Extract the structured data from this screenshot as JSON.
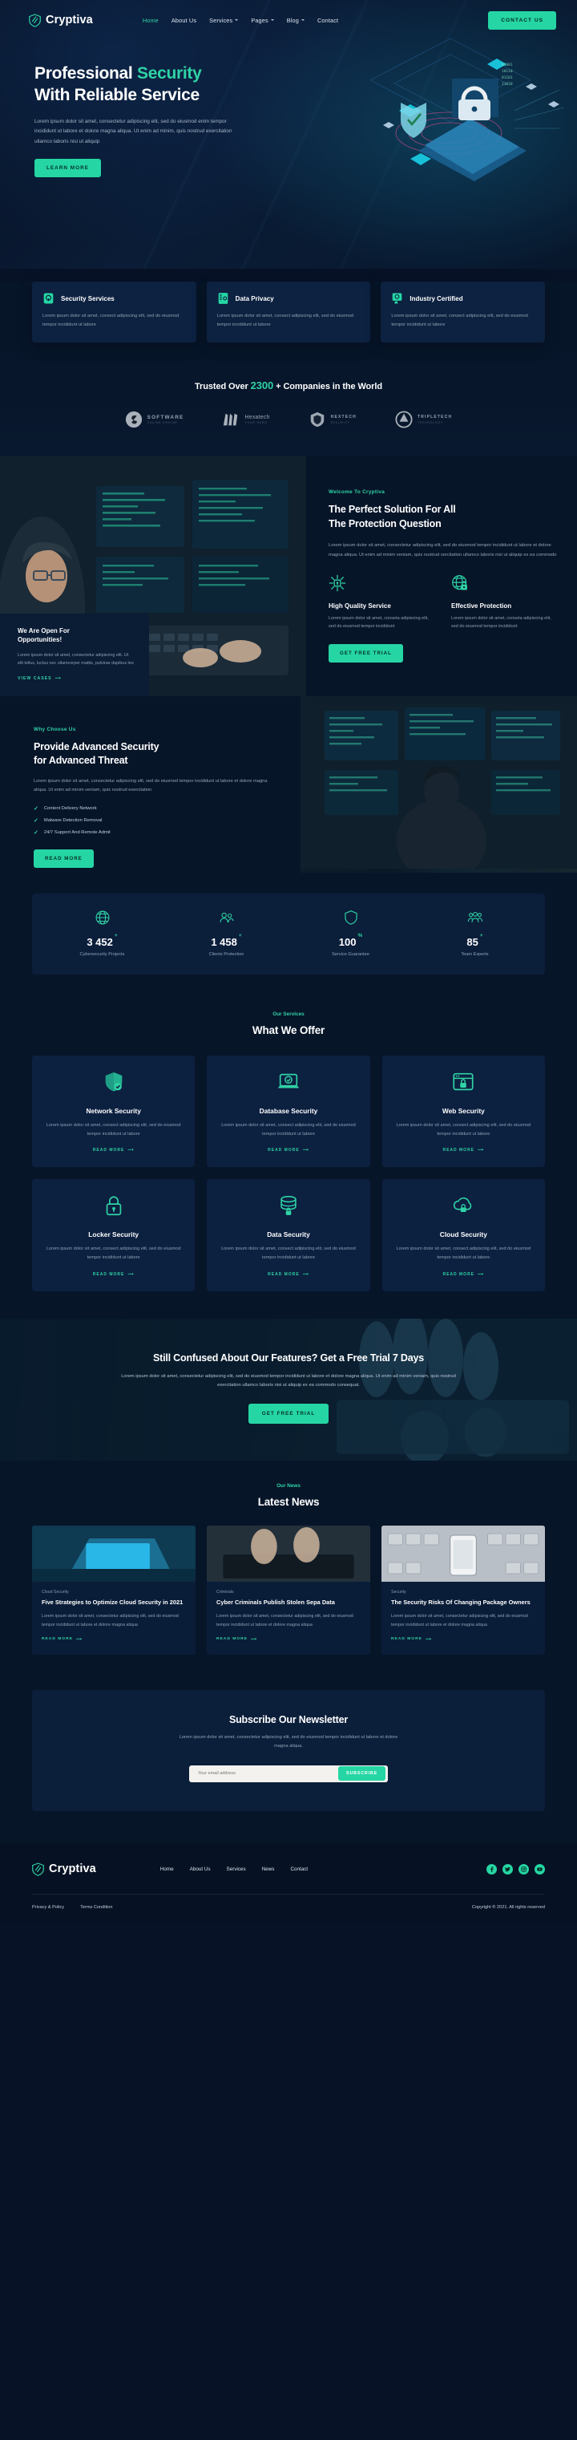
{
  "brand": {
    "name": "Cryptiva",
    "icon": "shield-icon"
  },
  "nav": {
    "items": [
      {
        "label": "Home",
        "active": true,
        "caret": false
      },
      {
        "label": "About Us",
        "active": false,
        "caret": false
      },
      {
        "label": "Services",
        "active": false,
        "caret": true
      },
      {
        "label": "Pages",
        "active": false,
        "caret": true
      },
      {
        "label": "Blog",
        "active": false,
        "caret": true
      },
      {
        "label": "Contact",
        "active": false,
        "caret": false
      }
    ],
    "cta": "CONTACT US"
  },
  "hero": {
    "title_line1_a": "Professional ",
    "title_line1_b": "Security",
    "title_line2": "With Reliable Service",
    "text": "Lorem ipsum dolor sit amet, consectetur adipiscing elit, sed do eiusmod enim tempor incididunt ut labore et dolore magna aliqua. Ut enim ad minim, quis nostrud exercitation ullamco laboris nisi ut aliquip",
    "button": "LEARN MORE"
  },
  "features": [
    {
      "icon": "lock-shield-icon",
      "title": "Security Services",
      "text": "Lorem ipsum dolor sit amet, consect adipiscing elit, sed do eiusmod tempor incididunt ut labore"
    },
    {
      "icon": "document-lock-icon",
      "title": "Data Privacy",
      "text": "Lorem ipsum dolor sit amet, consect adipiscing elit, sed do eiusmod tempor incididunt ut labore"
    },
    {
      "icon": "certificate-icon",
      "title": "Industry Certified",
      "text": "Lorem ipsum dolor sit amet, consect adipiscing elit, sed do eiusmod tempor incididunt ut labore"
    }
  ],
  "trusted": {
    "prefix": "Trusted Over ",
    "number": "2300",
    "suffix": " + Companies in the World",
    "logos": [
      {
        "icon": "swirl-logo-icon",
        "name": "SOFTWARE",
        "sub": "ONLINE ENGINE"
      },
      {
        "icon": "bars-logo-icon",
        "name": "Hexatech",
        "sub": "YOUR HERO"
      },
      {
        "icon": "shield-logo-icon",
        "name": "HEXTECH",
        "sub": "SECURITY"
      },
      {
        "icon": "circle-logo-icon",
        "name": "TRIPLETECH",
        "sub": "TECHNOLOGY"
      }
    ]
  },
  "about": {
    "eyebrow": "Welcome To Cryptiva",
    "title_line1": "The Perfect Solution For All",
    "title_line2": "The Protection Question",
    "text": "Lorem ipsum dolor sit amet, consectetur adipiscing elit, sed do eiusmod tempor incididunt ut labore et dolore magna aliqua. Ut enim ad minim veniam, quis nostrud xercitation ullamco laboris nisi ut aliquip ex ea commodo",
    "minis": [
      {
        "icon": "lock-network-icon",
        "title": "High Quality Service",
        "text": "Lorem ipsum dolor sit amet, conseta adipiscing elit, sed do eiusmod tempor incididunt"
      },
      {
        "icon": "globe-lock-icon",
        "title": "Effective Protection",
        "text": "Lorem ipsum dolor sit amet, conseta adipiscing elit, sed do eiusmod tempor incididunt"
      }
    ],
    "button": "GET FREE TRIAL",
    "open_box": {
      "title_line1": "We Are Open For",
      "title_line2": "Opportunities!",
      "text": "Lorem ipsum dolor sit amet, consectetur adipiscing elit. Ut elit tellus, luctus nec ullamcorper mattis, pulvinar dapibus leo",
      "link": "VIEW CASES"
    }
  },
  "why": {
    "eyebrow": "Why Choose Us",
    "title_line1": "Provide Advanced Security",
    "title_line2": "for Advanced Threat",
    "text": "Lorem ipsum dolor sit amet, consectetur adipiscing elit, sed do eiusmod tempor incididunt ut labore et dolore magna aliqua. Ut enim ad minim veniam, quis nostrud exercitation",
    "checks": [
      "Content Delivery Network",
      "Malware Detection Removal",
      "24/7 Support And Remote Admit"
    ],
    "button": "READ MORE"
  },
  "counters": [
    {
      "icon": "globe-icon",
      "value": "3 452",
      "sup": "+",
      "label": "Cybersecurity Projects"
    },
    {
      "icon": "users-icon",
      "value": "1 458",
      "sup": "+",
      "label": "Clients Protection"
    },
    {
      "icon": "shield-check-icon",
      "value": "100",
      "sup": "%",
      "label": "Service Guarantee"
    },
    {
      "icon": "team-icon",
      "value": "85",
      "sup": "+",
      "label": "Team Experts"
    }
  ],
  "services": {
    "eyebrow": "Our Services",
    "title": "What We Offer",
    "more_label": "READ MORE",
    "cards": [
      {
        "icon": "shield-check-icon",
        "title": "Network Security",
        "text": "Lorem ipsum dolor sit amet, consect adipiscing elit, sed do eiusmod tempor incididunt ut labore"
      },
      {
        "icon": "laptop-shield-icon",
        "title": "Database Security",
        "text": "Lorem ipsum dolor sit amet, consect adipiscing elit, sed do eiusmod tempor incididunt ut labore"
      },
      {
        "icon": "browser-lock-icon",
        "title": "Web Security",
        "text": "Lorem ipsum dolor sit amet, consect adipiscing elit, sed do eiusmod tempor incididunt ut labore"
      },
      {
        "icon": "padlock-icon",
        "title": "Locker Security",
        "text": "Lorem ipsum dolor sit amet, consect adipiscing elit, sed do eiusmod tempor incididunt ut labore"
      },
      {
        "icon": "database-lock-icon",
        "title": "Data Security",
        "text": "Lorem ipsum dolor sit amet, consect adipiscing elit, sed do eiusmod tempor incididunt ut labore"
      },
      {
        "icon": "cloud-lock-icon",
        "title": "Cloud Security",
        "text": "Lorem ipsum dolor sit amet, consect adipiscing elit, sed do eiusmod tempor incididunt ut labore"
      }
    ]
  },
  "cta": {
    "title": "Still Confused About Our Features? Get a Free Trial 7 Days",
    "text": "Lorem ipsum dolor sit amet, consectetur adipiscing elit, sed do eiusmod tempor incididunt ut labore et dolore magna aliqua. Ut enim ad minim veniam, quis nostrud exercitation ullamco laboris nisi ut aliquip ex ea commodo consequat.",
    "button": "GET FREE TRIAL"
  },
  "news": {
    "eyebrow": "Our News",
    "title": "Latest News",
    "more_label": "READ MORE",
    "cards": [
      {
        "image": "laptop-blue-photo",
        "category": "Cloud Security",
        "title": "Five Strategies to Optimize Cloud Security in 2021",
        "text": "Lorem ipsum dolor sit amet, consectetur adipiscing elit, sed do eiusmod tempor incididunt ut labore et dolore magna aliqua"
      },
      {
        "image": "hands-keyboard-photo",
        "category": "Criminals",
        "title": "Cyber Criminals Publish Stolen Sepa Data",
        "text": "Lorem ipsum dolor sit amet, consectetur adipiscing elit, sed do eiusmod tempor incididunt ut labore et dolore magna aliqua"
      },
      {
        "image": "phone-keyboard-photo",
        "category": "Security",
        "title": "The Security Risks Of Changing Package Owners",
        "text": "Lorem ipsum dolor sit amet, consectetur adipiscing elit, sed do eiusmod tempor incididunt ut labore et dolore magna aliqua"
      }
    ]
  },
  "newsletter": {
    "title": "Subscribe Our Newsletter",
    "text": "Lorem ipsum dolor sit amet, consectetur adipiscing elit, sed do eiusmod tempor incididunt ut labore et dolore magna aliqua.",
    "placeholder": "Your email address",
    "button": "SUBSCRIBE"
  },
  "footer": {
    "links": [
      "Home",
      "About Us",
      "Services",
      "News",
      "Contact"
    ],
    "socials": [
      "facebook-icon",
      "twitter-icon",
      "instagram-icon",
      "youtube-icon"
    ],
    "privacy": "Privacy & Policy",
    "terms": "Terms Condition",
    "copyright": "Copyright ® 2021. All rights reserved"
  },
  "colors": {
    "accent": "#25d6a4",
    "accent_text": "#2fd3a5",
    "bg_dark": "#071529",
    "card": "#0c2040"
  }
}
